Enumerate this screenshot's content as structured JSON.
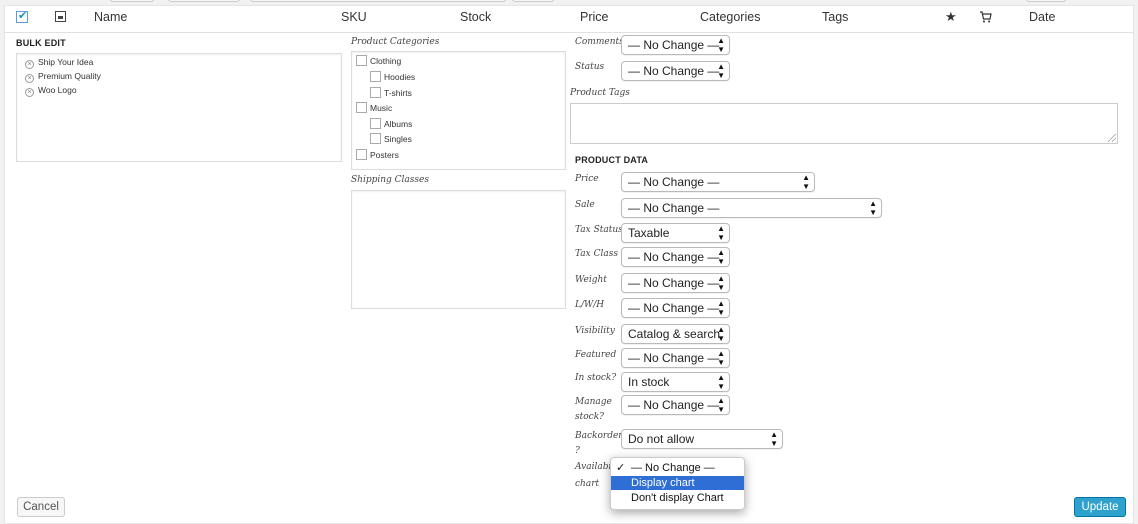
{
  "table_header": {
    "name": "Name",
    "sku": "SKU",
    "stock": "Stock",
    "price": "Price",
    "categories": "Categories",
    "tags": "Tags",
    "date": "Date",
    "star_icon": "★"
  },
  "bulk_edit": {
    "title": "BULK EDIT",
    "items": [
      "Ship Your Idea",
      "Premium Quality",
      "Woo Logo"
    ]
  },
  "product_categories": {
    "label": "Product Categories",
    "items": [
      {
        "name": "Clothing",
        "level": 0
      },
      {
        "name": "Hoodies",
        "level": 1
      },
      {
        "name": "T-shirts",
        "level": 1
      },
      {
        "name": "Music",
        "level": 0
      },
      {
        "name": "Albums",
        "level": 1
      },
      {
        "name": "Singles",
        "level": 1
      },
      {
        "name": "Posters",
        "level": 0
      }
    ]
  },
  "shipping_classes": {
    "label": "Shipping Classes"
  },
  "fields": {
    "comments": {
      "label": "Comments",
      "value": "— No Change —"
    },
    "status": {
      "label": "Status",
      "value": "— No Change —"
    },
    "product_tags": {
      "label": "Product Tags"
    },
    "product_data_title": "PRODUCT DATA",
    "price": {
      "label": "Price",
      "value": "— No Change —"
    },
    "sale": {
      "label": "Sale",
      "value": "— No Change —"
    },
    "tax_status": {
      "label": "Tax Status",
      "value": "Taxable"
    },
    "tax_class": {
      "label": "Tax Class",
      "value": "— No Change —"
    },
    "weight": {
      "label": "Weight",
      "value": "— No Change —"
    },
    "lwh": {
      "label": "L/W/H",
      "value": "— No Change —"
    },
    "visibility": {
      "label": "Visibility",
      "value": "Catalog & search"
    },
    "featured": {
      "label": "Featured",
      "value": "— No Change —"
    },
    "in_stock": {
      "label": "In stock?",
      "value": "In stock"
    },
    "manage_stock": {
      "label_1": "Manage",
      "label_2": "stock?",
      "value": "— No Change —"
    },
    "backorders": {
      "label_1": "Backorders",
      "label_2": "?",
      "value": "Do not allow"
    },
    "availability_chart": {
      "label_1": "Availabili",
      "label_2": "chart",
      "options": [
        "— No Change —",
        "Display chart",
        "Don't display Chart"
      ],
      "checked": "— No Change —",
      "highlighted": "Display chart"
    }
  },
  "buttons": {
    "cancel": "Cancel",
    "update": "Update"
  },
  "colors": {
    "primary": "#2ea2cc",
    "highlight": "#2f6ed5"
  }
}
